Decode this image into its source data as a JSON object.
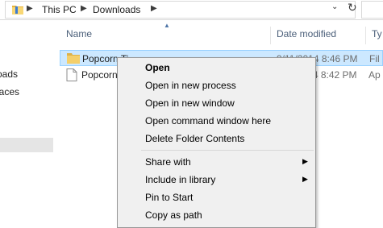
{
  "address": {
    "crumbs": [
      "This PC",
      "Downloads"
    ],
    "separator": "▶",
    "dropdown_icon": "chevron-down-icon",
    "refresh_icon": "refresh-icon"
  },
  "nav": {
    "items": [
      "oads",
      "laces"
    ]
  },
  "columns": {
    "name": "Name",
    "date": "Date modified",
    "type": "Ty"
  },
  "files": [
    {
      "name": "Popcorn Ti",
      "date": "9/11/2014 8:46 PM",
      "type": "Fil",
      "icon": "folder-icon",
      "selected": true
    },
    {
      "name": "Popcorn",
      "date": "9/11/2014 8:42 PM",
      "type": "Ap",
      "icon": "file-icon",
      "selected": false
    }
  ],
  "context_menu": {
    "groups": [
      [
        {
          "label": "Open",
          "bold": true
        },
        {
          "label": "Open in new process"
        },
        {
          "label": "Open in new window"
        },
        {
          "label": "Open command window here"
        },
        {
          "label": "Delete Folder Contents"
        }
      ],
      [
        {
          "label": "Share with",
          "submenu": true
        },
        {
          "label": "Include in library",
          "submenu": true
        },
        {
          "label": "Pin to Start"
        },
        {
          "label": "Copy as path"
        }
      ]
    ],
    "submenu_arrow": "▶"
  },
  "colors": {
    "selection_bg": "#cce8ff",
    "selection_border": "#99d1ff",
    "menu_bg": "#f0f0f0",
    "header_text": "#4c607a"
  }
}
